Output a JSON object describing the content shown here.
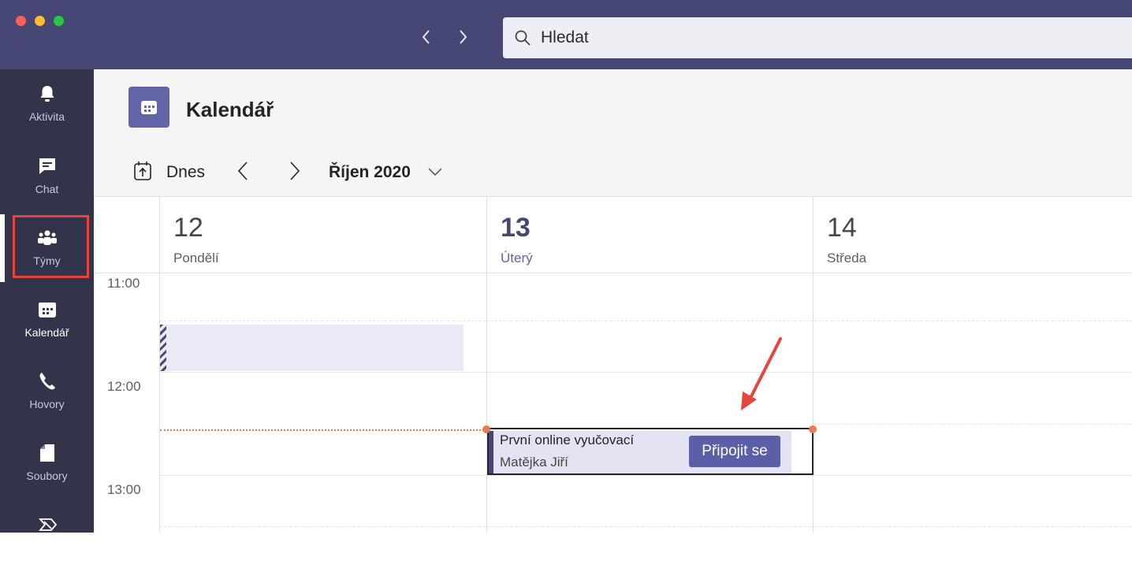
{
  "window": {
    "traffic_lights": {
      "close": "#ff5f57",
      "minimize": "#febc2e",
      "zoom": "#28c840"
    }
  },
  "search": {
    "placeholder": "Hledat"
  },
  "sidebar": {
    "items": [
      {
        "label": "Aktivita",
        "icon": "bell-icon"
      },
      {
        "label": "Chat",
        "icon": "chat-icon"
      },
      {
        "label": "Týmy",
        "icon": "teams-icon"
      },
      {
        "label": "Kalendář",
        "icon": "calendar-icon",
        "active": true
      },
      {
        "label": "Hovory",
        "icon": "phone-icon"
      },
      {
        "label": "Soubory",
        "icon": "files-icon"
      },
      {
        "label": "",
        "icon": "apps-icon"
      }
    ]
  },
  "header": {
    "title": "Kalendář"
  },
  "toolbar": {
    "today_label": "Dnes",
    "month_label": "Říjen 2020"
  },
  "days": [
    {
      "num": "12",
      "name": "Pondělí",
      "today": false
    },
    {
      "num": "13",
      "name": "Úterý",
      "today": true
    },
    {
      "num": "14",
      "name": "Středa",
      "today": false
    }
  ],
  "times": [
    "11:00",
    "12:00",
    "13:00"
  ],
  "meeting": {
    "title": "První online vyučovací",
    "organizer": "Matějka Jiří",
    "join_label": "Připojit se"
  },
  "colors": {
    "titlebar": "#464775",
    "rail": "#33344a",
    "accent": "#6264a7",
    "now_line": "#e87c52",
    "highlight": "#e6453b"
  }
}
